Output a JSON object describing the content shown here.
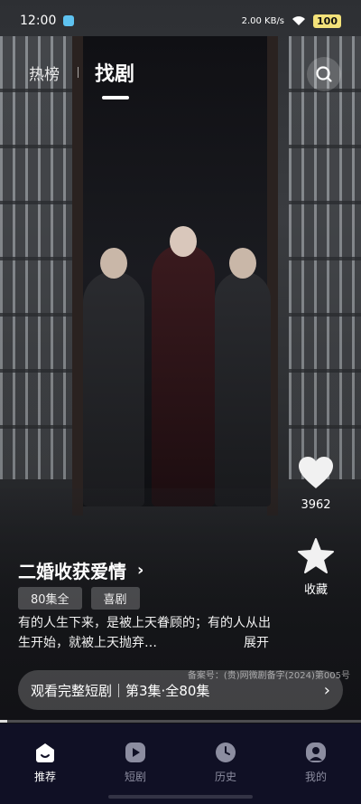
{
  "status_bar": {
    "time": "12:00",
    "network_speed": "2.00 KB/s",
    "battery": "100"
  },
  "top_nav": {
    "tab_hot": "热榜",
    "tab_find": "找剧"
  },
  "actions": {
    "like_count": "3962",
    "favorite_label": "收藏"
  },
  "drama": {
    "title": "二婚收获爱情",
    "tags": [
      "80集全",
      "喜剧"
    ],
    "description": "有的人生下来，是被上天眷顾的；有的人从出生开始，就被上天抛弃…",
    "expand_label": "展开",
    "license": "备案号：(贵)网微剧备字(2024)第005号",
    "watch_label": "观看完整短剧｜第3集·全80集",
    "progress": 0.02
  },
  "bottom_nav": [
    {
      "label": "推荐",
      "icon": "home-icon",
      "active": true
    },
    {
      "label": "短剧",
      "icon": "play-icon",
      "active": false
    },
    {
      "label": "历史",
      "icon": "clock-icon",
      "active": false
    },
    {
      "label": "我的",
      "icon": "profile-icon",
      "active": false
    }
  ],
  "colors": {
    "nav_bg": "#101025",
    "battery": "#f3e27a"
  }
}
